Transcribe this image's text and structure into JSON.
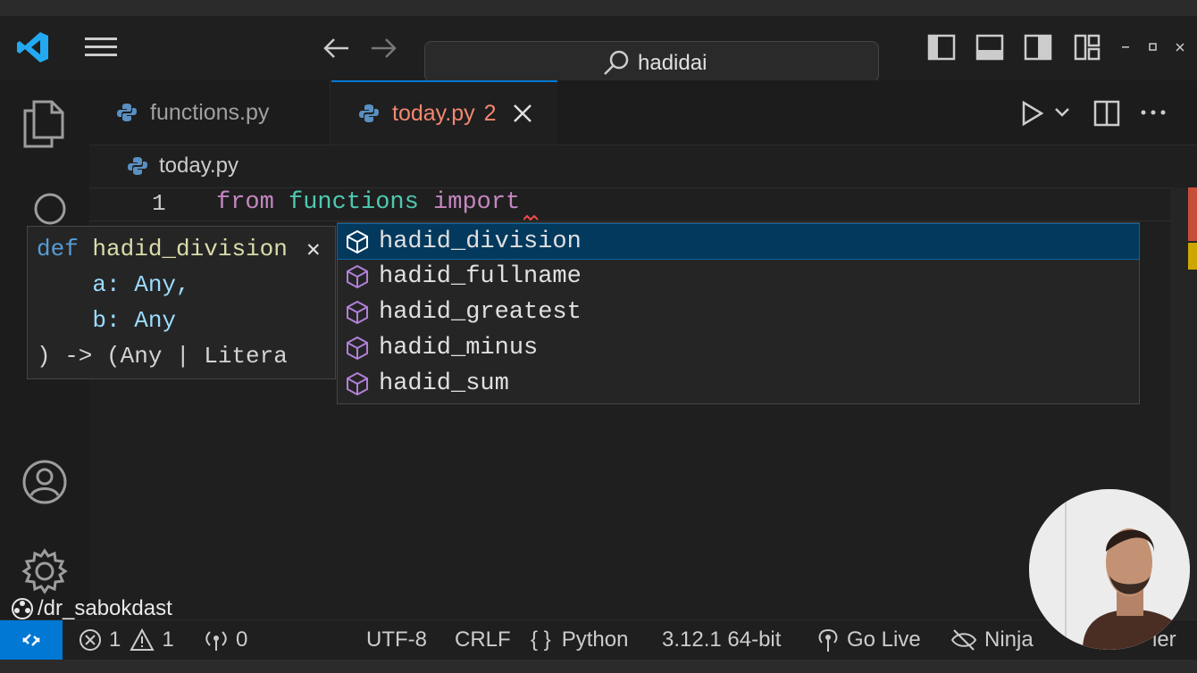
{
  "title_bar": {
    "search_text": "hadidai"
  },
  "tabs": [
    {
      "label": "functions.py",
      "badge": ""
    },
    {
      "label": "today.py",
      "badge": "2"
    }
  ],
  "breadcrumb": {
    "file": "today.py"
  },
  "editor": {
    "line_number": "1",
    "keyword_from": "from",
    "module": "functions",
    "keyword_import": "import"
  },
  "hover": {
    "lines": [
      "def hadid_division",
      "    a: Any,",
      "    b: Any",
      ") -> (Any | Litera"
    ],
    "close": "✕"
  },
  "suggestions": [
    {
      "label": "hadid_division",
      "selected": true
    },
    {
      "label": "hadid_fullname",
      "selected": false
    },
    {
      "label": "hadid_greatest",
      "selected": false
    },
    {
      "label": "hadid_minus",
      "selected": false
    },
    {
      "label": "hadid_sum",
      "selected": false
    }
  ],
  "watermark": "/dr_sabokdast",
  "status_bar": {
    "errors": "1",
    "warnings": "1",
    "ports": "0",
    "encoding": "UTF-8",
    "eol": "CRLF",
    "language": "Python",
    "interpreter": "3.12.1 64-bit",
    "go_live": "Go Live",
    "ninja": "Ninja",
    "last": "ier"
  },
  "colors": {
    "accent": "#0078d4",
    "selected_suggestion": "#04395e",
    "keyword": "#c586c0",
    "module": "#4ec9b0",
    "modified_tab": "#f48771",
    "suggestion_icon": "#b180d7"
  },
  "icons": [
    "vscode-logo-icon",
    "menu-icon",
    "back-arrow-icon",
    "forward-arrow-icon",
    "search-icon",
    "toggle-primary-sidebar-icon",
    "toggle-panel-icon",
    "toggle-secondary-sidebar-icon",
    "customize-layout-icon",
    "minimize-icon",
    "maximize-icon",
    "close-icon",
    "explorer-icon",
    "search-activity-icon",
    "account-icon",
    "settings-gear-icon",
    "python-file-icon",
    "run-icon",
    "split-editor-icon",
    "more-actions-icon",
    "symbol-cube-icon",
    "remote-icon",
    "error-icon",
    "warning-icon",
    "broadcast-icon",
    "braces-icon",
    "go-live-icon",
    "ninja-eye-icon"
  ]
}
